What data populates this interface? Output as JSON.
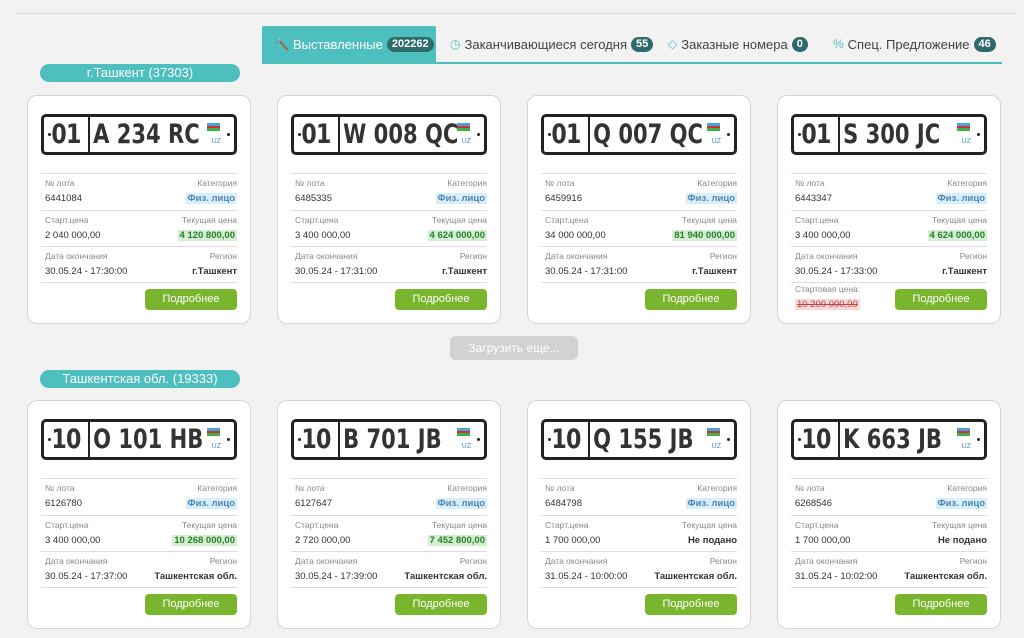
{
  "tabs": [
    {
      "icon": "gavel-icon",
      "glyph": "🔨",
      "label": "Выставленные",
      "count": "202262"
    },
    {
      "icon": "clock-icon",
      "glyph": "◷",
      "label": "Заканчивающиеся сегодня",
      "count": "55"
    },
    {
      "icon": "diamond-icon",
      "glyph": "◇",
      "label": "Заказные номера",
      "count": "0"
    },
    {
      "icon": "percent-icon",
      "glyph": "%",
      "label": "Спец. Предложение",
      "count": "46"
    }
  ],
  "labels": {
    "lot": "№ лота",
    "category": "Категория",
    "start_price": "Старт.цена",
    "current_price": "Текущая цена",
    "end_date": "Дата окончания",
    "region": "Регион",
    "more": "Подробнее",
    "uz": "UZ",
    "start_price_alt": "Стартовая цена:"
  },
  "groups": [
    {
      "title": "г.Ташкент (37303)",
      "cards": [
        {
          "code": "01",
          "number": "A 234 RC",
          "lot": "6441084",
          "category": "Физ. лицо",
          "start": "2 040 000,00",
          "current": "4 120 800,00",
          "date": "30.05.24 - 17:30:00",
          "region": "г.Ташкент"
        },
        {
          "code": "01",
          "number": "W 008 QC",
          "lot": "6485335",
          "category": "Физ. лицо",
          "start": "3 400 000,00",
          "current": "4 624 000,00",
          "date": "30.05.24 - 17:31:00",
          "region": "г.Ташкент"
        },
        {
          "code": "01",
          "number": "Q 007 QC",
          "lot": "6459916",
          "category": "Физ. лицо",
          "start": "34 000 000,00",
          "current": "81 940 000,00",
          "date": "30.05.24 - 17:31:00",
          "region": "г.Ташкент"
        },
        {
          "code": "01",
          "number": "S 300 JC",
          "lot": "6443347",
          "category": "Физ. лицо",
          "start": "3 400 000,00",
          "current": "4 624 000,00",
          "date": "30.05.24 - 17:33:00",
          "region": "г.Ташкент",
          "old_start": "10 200 000,00"
        }
      ]
    },
    {
      "title": "Ташкентская обл. (19333)",
      "cards": [
        {
          "code": "10",
          "number": "O 101 HB",
          "lot": "6126780",
          "category": "Физ. лицо",
          "start": "3 400 000,00",
          "current": "10 268 000,00",
          "date": "30.05.24 - 17:37:00",
          "region": "Ташкентская обл."
        },
        {
          "code": "10",
          "number": "B 701 JB",
          "lot": "6127647",
          "category": "Физ. лицо",
          "start": "2 720 000,00",
          "current": "7 452 800,00",
          "date": "30.05.24 - 17:39:00",
          "region": "Ташкентская обл."
        },
        {
          "code": "10",
          "number": "Q 155 JB",
          "lot": "6484798",
          "category": "Физ. лицо",
          "start": "1 700 000,00",
          "current": "Не подано",
          "date": "31.05.24 - 10:00:00",
          "region": "Ташкентская обл."
        },
        {
          "code": "10",
          "number": "K 663 JB",
          "lot": "6268546",
          "category": "Физ. лицо",
          "start": "1 700 000,00",
          "current": "Не подано",
          "date": "31.05.24 - 10:02:00",
          "region": "Ташкентская обл."
        }
      ]
    }
  ],
  "load_more": "Загрузить еще..."
}
